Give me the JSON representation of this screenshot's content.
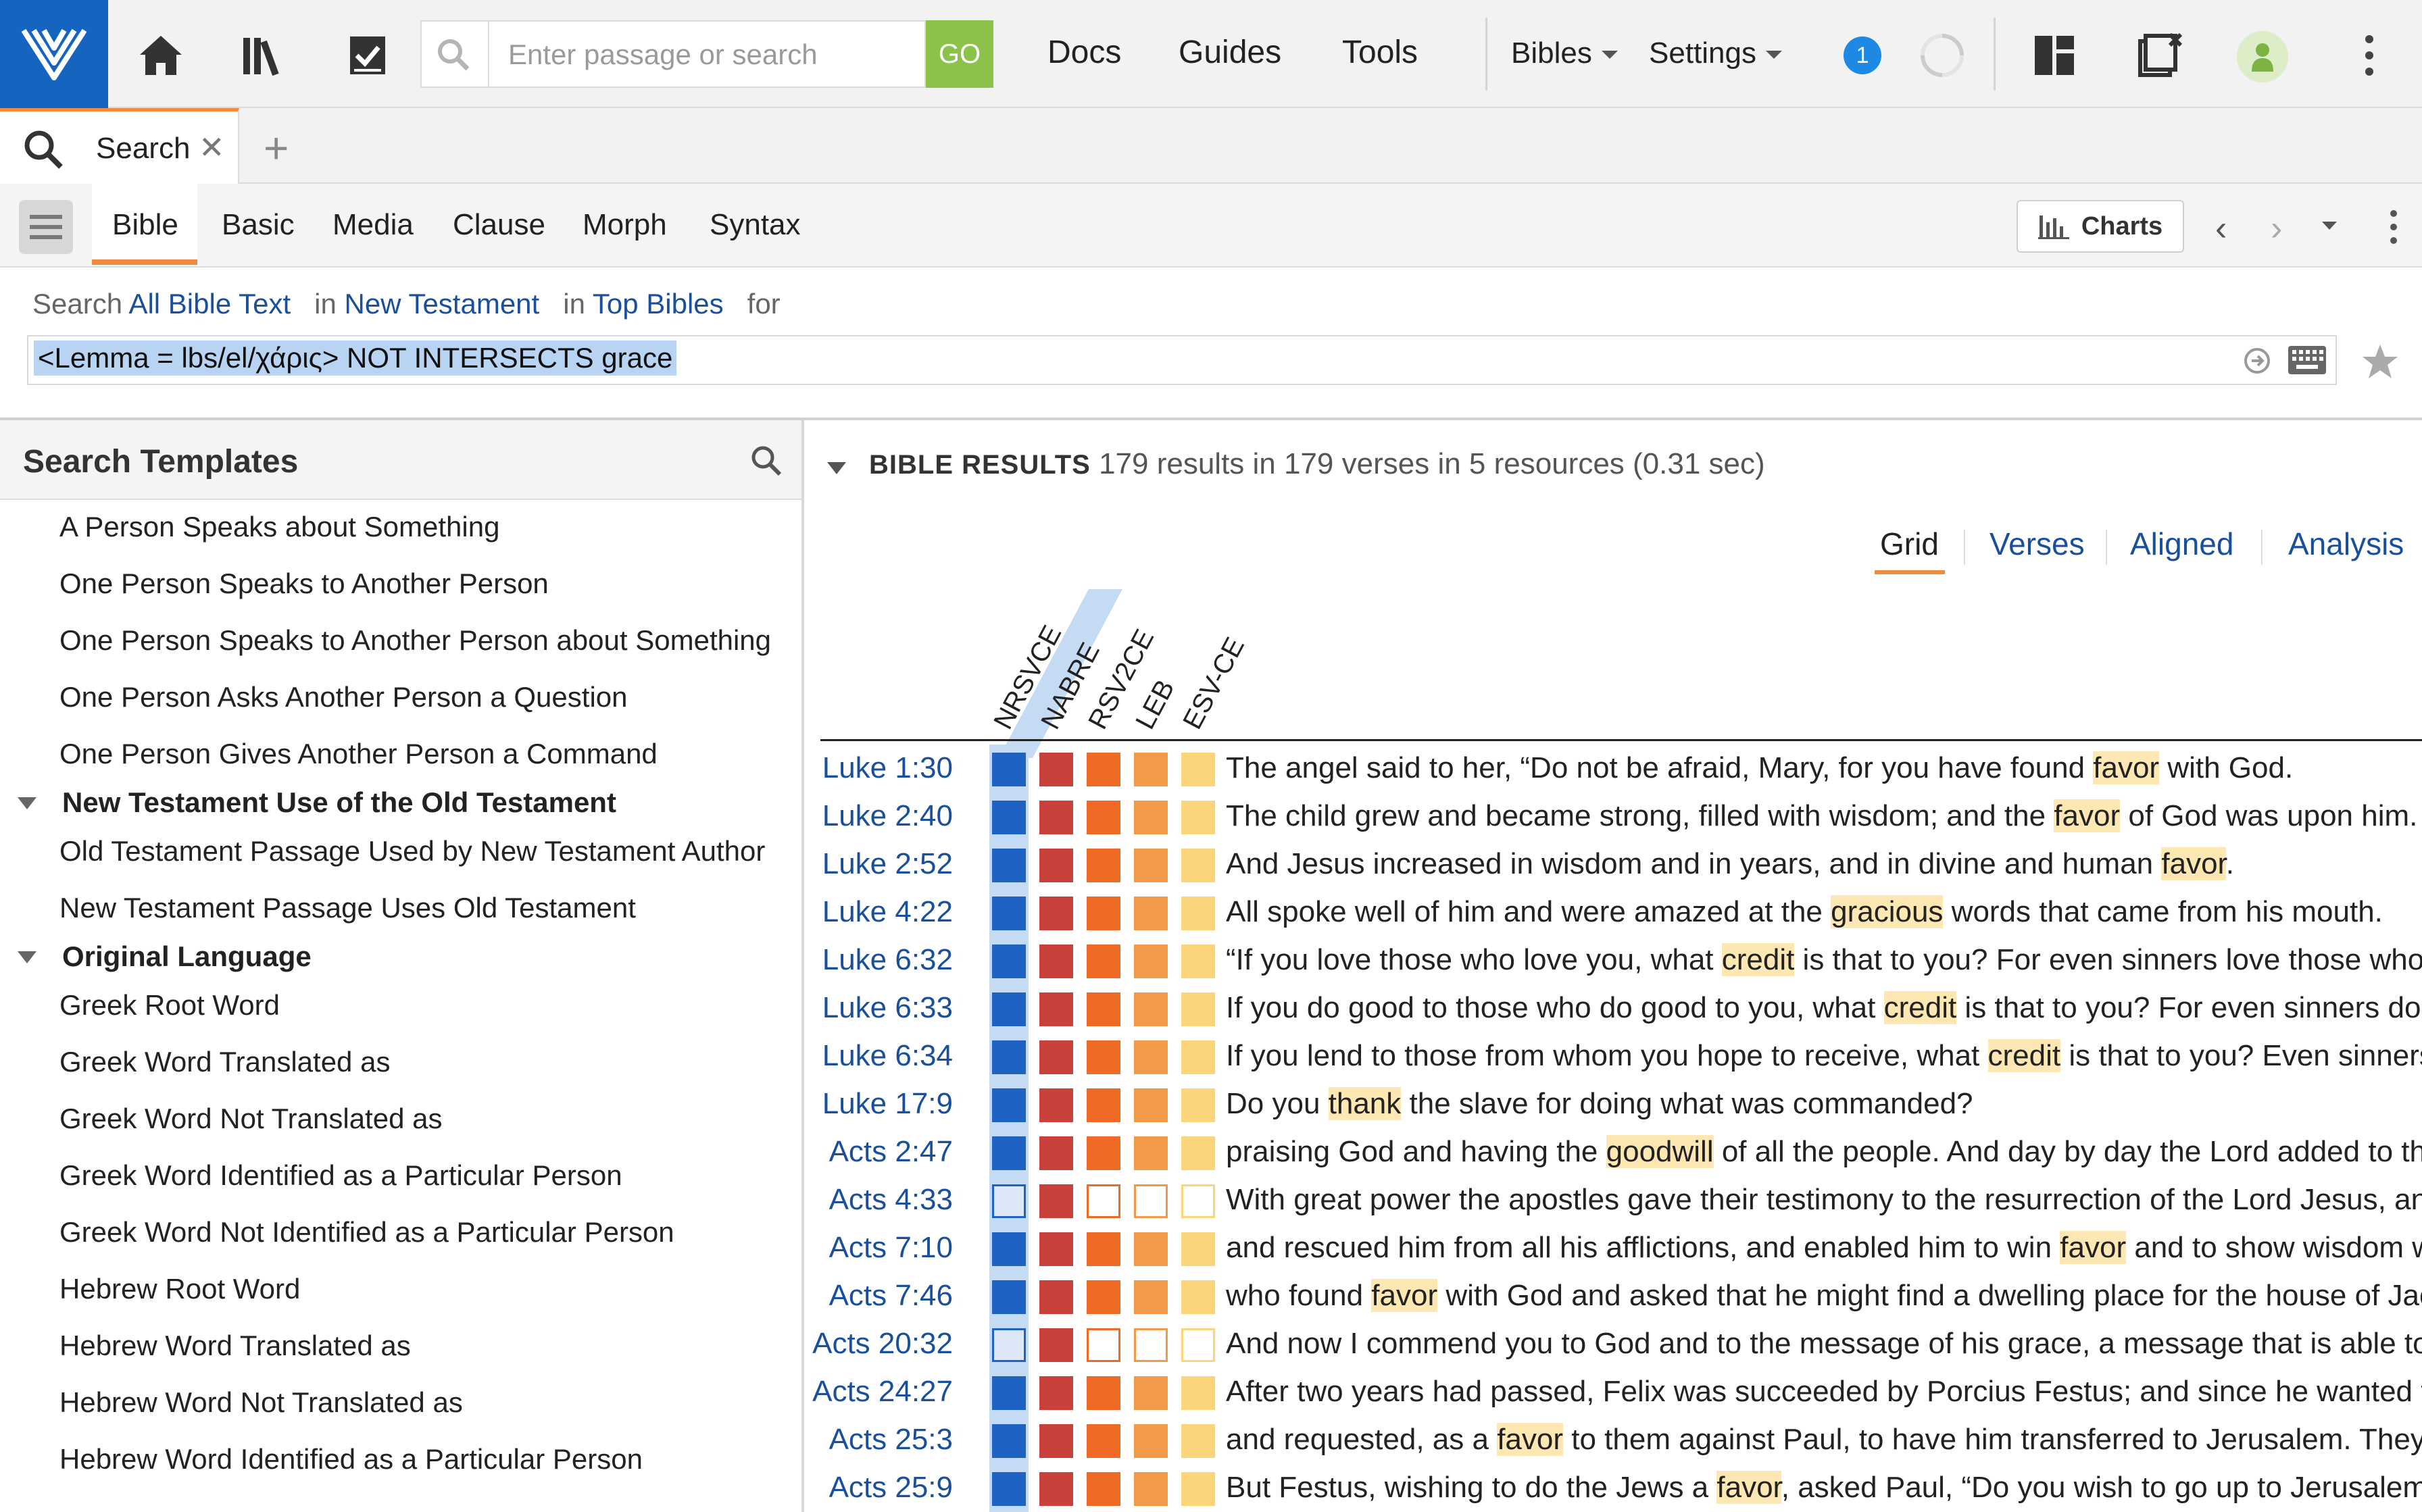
{
  "topbar": {
    "search_placeholder": "Enter passage or search",
    "go_label": "GO",
    "nav": [
      "Docs",
      "Guides",
      "Tools"
    ],
    "menus": [
      "Bibles",
      "Settings"
    ],
    "badge_count": "1"
  },
  "tab": {
    "label": "Search"
  },
  "search_tabs": [
    "Bible",
    "Basic",
    "Media",
    "Clause",
    "Morph",
    "Syntax"
  ],
  "charts_label": "Charts",
  "query": {
    "prefix": "Search",
    "scope": "All Bible Text",
    "in1": "in",
    "range": "New Testament",
    "in2": "in",
    "collection": "Top Bibles",
    "for": "for",
    "text": "<Lemma = lbs/el/χάρις> NOT INTERSECTS grace"
  },
  "templates": {
    "title": "Search Templates",
    "items": [
      "A Person Speaks about Something",
      "One Person Speaks to Another Person",
      "One Person Speaks to Another Person about Something",
      "One Person Asks Another Person a Question",
      "One Person Gives Another Person a Command"
    ],
    "group1": "New Testament Use of the Old Testament",
    "group1_items": [
      "Old Testament Passage Used by New Testament Author",
      "New Testament Passage Uses Old Testament"
    ],
    "group2": "Original Language",
    "group2_items": [
      "Greek Root Word",
      "Greek Word Translated as",
      "Greek Word Not Translated as",
      "Greek Word Identified as a Particular Person",
      "Greek Word Not Identified as a Particular Person",
      "Hebrew Root Word",
      "Hebrew Word Translated as",
      "Hebrew Word Not Translated as",
      "Hebrew Word Identified as a Particular Person"
    ]
  },
  "results": {
    "heading": "BIBLE RESULTS",
    "summary": "179 results in 179 verses in 5 resources (0.31 sec)",
    "views": [
      "Grid",
      "Verses",
      "Aligned",
      "Analysis"
    ],
    "columns": [
      "NRSVCE",
      "NABRE",
      "RSV2CE",
      "LEB",
      "ESV-CE"
    ],
    "column_colors": [
      "#1e62c4",
      "#c9413b",
      "#ee6a25",
      "#f19a48",
      "#fbd57a"
    ],
    "rows": [
      {
        "ref": "Luke 1:30",
        "filled": [
          true,
          true,
          true,
          true,
          true
        ],
        "pre": "The angel said to her, “Do not be afraid, Mary, for you have found ",
        "hl": "favor",
        "post": " with God."
      },
      {
        "ref": "Luke 2:40",
        "filled": [
          true,
          true,
          true,
          true,
          true
        ],
        "pre": "The child grew and became strong, filled with wisdom; and the ",
        "hl": "favor",
        "post": " of God was upon him."
      },
      {
        "ref": "Luke 2:52",
        "filled": [
          true,
          true,
          true,
          true,
          true
        ],
        "pre": "And Jesus increased in wisdom and in years, and in divine and human ",
        "hl": "favor",
        "post": "."
      },
      {
        "ref": "Luke 4:22",
        "filled": [
          true,
          true,
          true,
          true,
          true
        ],
        "pre": "All spoke well of him and were amazed at the ",
        "hl": "gracious",
        "post": " words that came from his mouth."
      },
      {
        "ref": "Luke 6:32",
        "filled": [
          true,
          true,
          true,
          true,
          true
        ],
        "pre": "“If you love those who love you, what ",
        "hl": "credit",
        "post": " is that to you? For even sinners love those who love them."
      },
      {
        "ref": "Luke 6:33",
        "filled": [
          true,
          true,
          true,
          true,
          true
        ],
        "pre": "If you do good to those who do good to you, what ",
        "hl": "credit",
        "post": " is that to you? For even sinners do the same."
      },
      {
        "ref": "Luke 6:34",
        "filled": [
          true,
          true,
          true,
          true,
          true
        ],
        "pre": "If you lend to those from whom you hope to receive, what ",
        "hl": "credit",
        "post": " is that to you? Even sinners lend to sinners."
      },
      {
        "ref": "Luke 17:9",
        "filled": [
          true,
          true,
          true,
          true,
          true
        ],
        "pre": "Do you ",
        "hl": "thank",
        "post": " the slave for doing what was commanded?"
      },
      {
        "ref": "Acts 2:47",
        "filled": [
          true,
          true,
          true,
          true,
          true
        ],
        "pre": "praising God and having the ",
        "hl": "goodwill",
        "post": " of all the people. And day by day the Lord added to their number."
      },
      {
        "ref": "Acts 4:33",
        "filled": [
          false,
          true,
          false,
          false,
          false
        ],
        "pre": "With great power the apostles gave their testimony to the resurrection of the Lord Jesus, and great grace was upon them all.",
        "hl": "",
        "post": ""
      },
      {
        "ref": "Acts 7:10",
        "filled": [
          true,
          true,
          true,
          true,
          true
        ],
        "pre": "and rescued him from all his afflictions, and enabled him to win ",
        "hl": "favor",
        "post": " and to show wisdom when he stood before Pharaoh."
      },
      {
        "ref": "Acts 7:46",
        "filled": [
          true,
          true,
          true,
          true,
          true
        ],
        "pre": "who found ",
        "hl": "favor",
        "post": " with God and asked that he might find a dwelling place for the house of Jacob."
      },
      {
        "ref": "Acts 20:32",
        "filled": [
          false,
          true,
          false,
          false,
          false
        ],
        "pre": "And now I commend you to God and to the message of his grace, a message that is able to build you up.",
        "hl": "",
        "post": ""
      },
      {
        "ref": "Acts 24:27",
        "filled": [
          true,
          true,
          true,
          true,
          true
        ],
        "pre": "After two years had passed, Felix was succeeded by Porcius Festus; and since he wanted to grant the Jews a favor.",
        "hl": "",
        "post": ""
      },
      {
        "ref": "Acts 25:3",
        "filled": [
          true,
          true,
          true,
          true,
          true
        ],
        "pre": "and requested, as a ",
        "hl": "favor",
        "post": " to them against Paul, to have him transferred to Jerusalem. They were planning."
      },
      {
        "ref": "Acts 25:9",
        "filled": [
          true,
          true,
          true,
          true,
          true
        ],
        "pre": "But Festus, wishing to do the Jews a ",
        "hl": "favor",
        "post": ", asked Paul, “Do you wish to go up to Jerusalem?"
      }
    ]
  }
}
